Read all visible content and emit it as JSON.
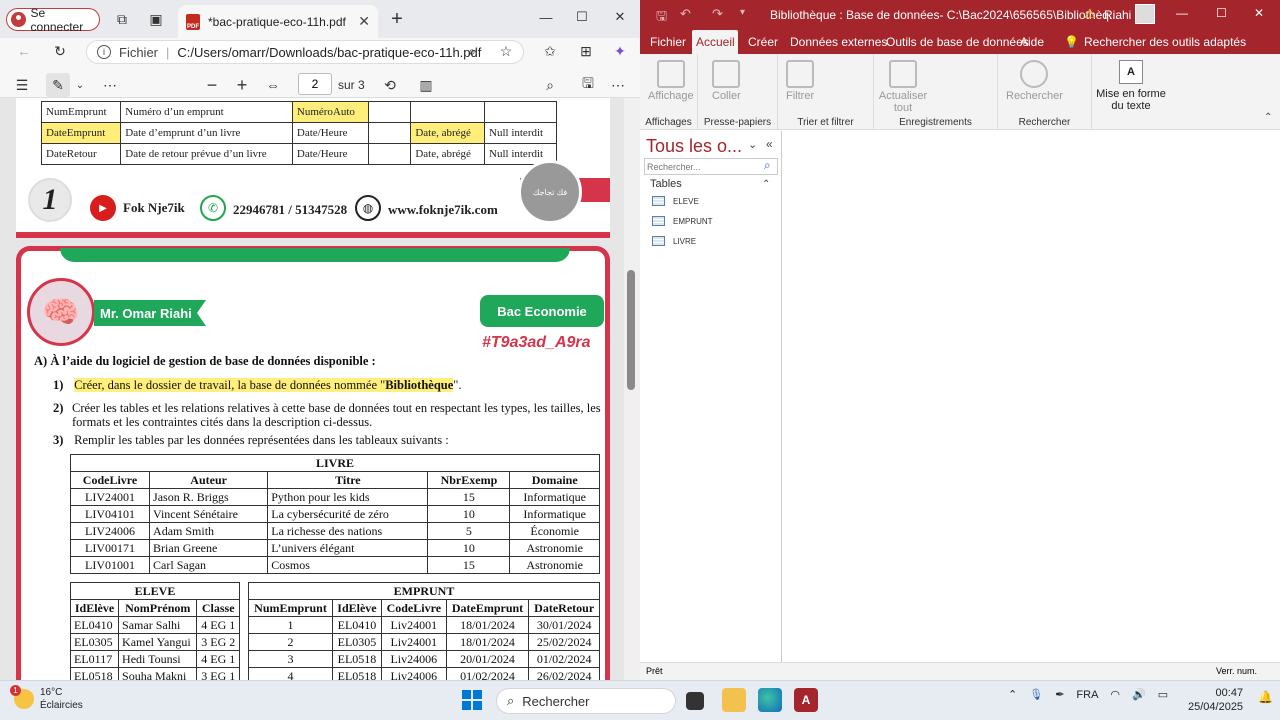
{
  "edge": {
    "signin_label": "Se connecter",
    "tab_title": "*bac-pratique-eco-11h.pdf",
    "url_label": "Fichier",
    "url": "C:/Users/omarr/Downloads/bac-pratique-eco-11h.pdf",
    "page_current": "2",
    "page_total": "sur 3"
  },
  "pdf": {
    "fields_table": [
      [
        "NumEmprunt",
        "Numéro d’un emprunt",
        "NuméroAuto",
        "",
        "",
        ""
      ],
      [
        "DateEmprunt",
        "Date d’emprunt d’un livre",
        "Date/Heure",
        "",
        "Date, abrégé",
        "Null interdit"
      ],
      [
        "DateRetour",
        "Date de retour prévue d’un livre",
        "Date/Heure",
        "",
        "Date, abrégé",
        "Null interdit"
      ]
    ],
    "contact": {
      "number_logo": "1",
      "youtube": "Fok Nje7ik",
      "phones": "22946781 / 51347528",
      "website": "www.foknje7ik.com",
      "badge": "فك تجاجك"
    },
    "teacher": "Mr. Omar Riahi",
    "section_button": "Bac Economie",
    "hashtag": "#T9a3ad_A9ra",
    "question_A": "A) À l’aide du logiciel de gestion de base de données disponible :",
    "q1_num": "1)",
    "q1_pre": "Créer, dans le dossier de travail, la base de données nommée \"",
    "q1_bold": "Bibliothèque",
    "q1_post": "\".",
    "q2_num": "2)",
    "q2_text": "Créer les tables et les relations relatives à cette base de données tout en respectant les types, les tailles, les formats et les contraintes cités dans la description ci-dessus.",
    "q3_num": "3)",
    "q3_text": "Remplir les tables par les données représentées dans les tableaux suivants :",
    "livre": {
      "title": "LIVRE",
      "headers": [
        "CodeLivre",
        "Auteur",
        "Titre",
        "NbrExemp",
        "Domaine"
      ],
      "rows": [
        [
          "LIV24001",
          "Jason R. Briggs",
          "Python pour les kids",
          "15",
          "Informatique"
        ],
        [
          "LIV04101",
          "Vincent Sénétaire",
          "La cybersécurité de zéro",
          "10",
          "Informatique"
        ],
        [
          "LIV24006",
          "Adam Smith",
          "La richesse des nations",
          "5",
          "Économie"
        ],
        [
          "LIV00171",
          "Brian Greene",
          "L’univers élégant",
          "10",
          "Astronomie"
        ],
        [
          "LIV01001",
          "Carl Sagan",
          "Cosmos",
          "15",
          "Astronomie"
        ]
      ]
    },
    "eleve": {
      "title": "ELEVE",
      "headers": [
        "IdElève",
        "NomPrénom",
        "Classe"
      ],
      "rows": [
        [
          "EL0410",
          "Samar Salhi",
          "4 EG 1"
        ],
        [
          "EL0305",
          "Kamel Yangui",
          "3 EG 2"
        ],
        [
          "EL0117",
          "Hedi Tounsi",
          "4 EG 1"
        ],
        [
          "EL0518",
          "Souha Makni",
          "3 EG 1"
        ]
      ]
    },
    "emprunt": {
      "title": "EMPRUNT",
      "headers": [
        "NumEmprunt",
        "IdElève",
        "CodeLivre",
        "DateEmprunt",
        "DateRetour"
      ],
      "rows": [
        [
          "1",
          "EL0410",
          "Liv24001",
          "18/01/2024",
          "30/01/2024"
        ],
        [
          "2",
          "EL0305",
          "Liv24001",
          "18/01/2024",
          "25/02/2024"
        ],
        [
          "3",
          "EL0518",
          "Liv24006",
          "20/01/2024",
          "01/02/2024"
        ],
        [
          "4",
          "EL0518",
          "Liv24006",
          "01/02/2024",
          "26/02/2024"
        ]
      ]
    }
  },
  "access": {
    "title": "Bibliothèque : Base de données- C:\\Bac2024\\656565\\Bibliothèq...",
    "user": "Riahi",
    "ribbon_tabs": [
      "Fichier",
      "Accueil",
      "Créer",
      "Données externes",
      "Outils de base de données",
      "Aide"
    ],
    "tell_me": "Rechercher des outils adaptés",
    "groups": {
      "affichages": "Affichages",
      "presse": "Presse-papiers",
      "trier": "Trier et filtrer",
      "enreg": "Enregistrements",
      "rechercher": "Rechercher"
    },
    "buttons": {
      "affichage": "Affichage",
      "coller": "Coller",
      "filtrer": "Filtrer",
      "actualiser": "Actualiser tout",
      "rechercher": "Rechercher",
      "mise_en_forme": "Mise en forme du texte"
    },
    "nav_title": "Tous les o...",
    "nav_search_placeholder": "Rechercher...",
    "nav_section": "Tables",
    "tables": [
      "ELEVE",
      "EMPRUNT",
      "LIVRE"
    ],
    "status_left": "Prêt",
    "status_right": "Verr. num."
  },
  "taskbar": {
    "temp": "16°C",
    "weather": "Éclaircies",
    "weather_badge": "1",
    "search": "Rechercher",
    "lang": "FRA",
    "time": "00:47",
    "date": "25/04/2025"
  },
  "colors": {
    "access_red": "#a4262c",
    "pdf_red": "#d6344a",
    "pdf_green": "#1fa85a",
    "highlight": "#ffef7a"
  }
}
